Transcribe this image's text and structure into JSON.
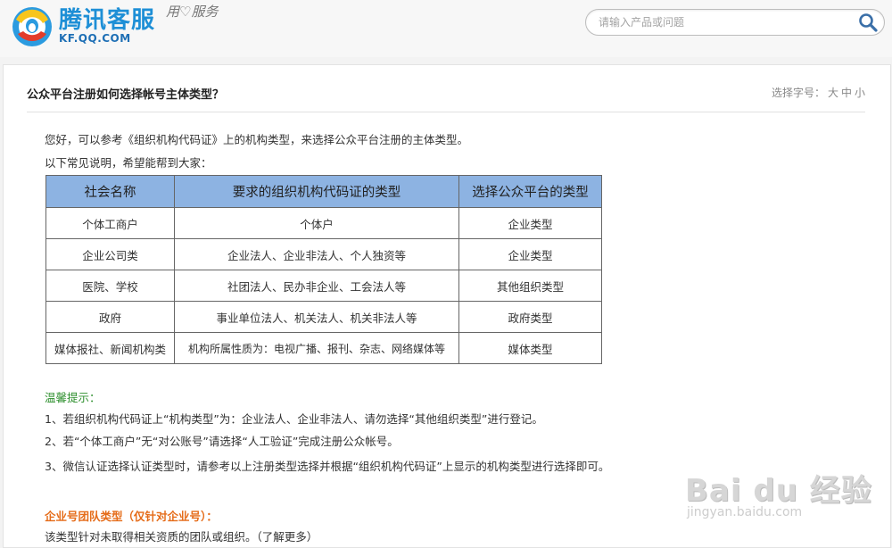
{
  "header": {
    "brand": "腾讯客服",
    "brand_url": "KF.QQ.COM",
    "slogan": "用♡服务",
    "search_placeholder": "请输入产品或问题"
  },
  "article": {
    "title": "公众平台注册如何选择帐号主体类型？",
    "font_size_label": "选择字号：",
    "font_size_options": [
      "大",
      "中",
      "小"
    ],
    "intro_1": "您好，可以参考《组织机构代码证》上的机构类型，来选择公众平台注册的主体类型。",
    "intro_2": "以下常见说明，希望能帮到大家：",
    "table": {
      "headers": [
        "社会名称",
        "要求的组织机构代码证的类型",
        "选择公众平台的类型"
      ],
      "rows": [
        [
          "个体工商户",
          "个体户",
          "企业类型"
        ],
        [
          "企业公司类",
          "企业法人、企业非法人、个人独资等",
          "企业类型"
        ],
        [
          "医院、学校",
          "社团法人、民办非企业、工会法人等",
          "其他组织类型"
        ],
        [
          "政府",
          "事业单位法人、机关法人、机关非法人等",
          "政府类型"
        ],
        [
          "媒体报社、新闻机构类",
          "机构所属性质为：电视广播、报刊、杂志、网络媒体等",
          "媒体类型"
        ]
      ]
    },
    "tips_title": "温馨提示：",
    "tip_1": "1、若组织机构代码证上“机构类型”为：企业法人、企业非法人、请勿选择“其他组织类型”进行登记。",
    "tip_2": "2、若“个体工商户”无“对公账号”请选择“人工验证”完成注册公众帐号。",
    "tip_3": "3、微信认证选择认证类型时，请参考以上注册类型选择并根据“组织机构代码证”上显示的机构类型进行选择即可。",
    "team_title": "企业号团队类型（仅针对企业号）：",
    "team_desc": "该类型针对未取得相关资质的团队或组织。（了解更多）"
  },
  "watermark": {
    "logo_text": "Bai du 经验",
    "domain": "jingyan.baidu.com"
  },
  "colors": {
    "brand_blue": "#1e8fd6",
    "table_header_bg": "#8db3e2",
    "tip_green": "#2d8f2d",
    "team_orange": "#e56c19"
  }
}
